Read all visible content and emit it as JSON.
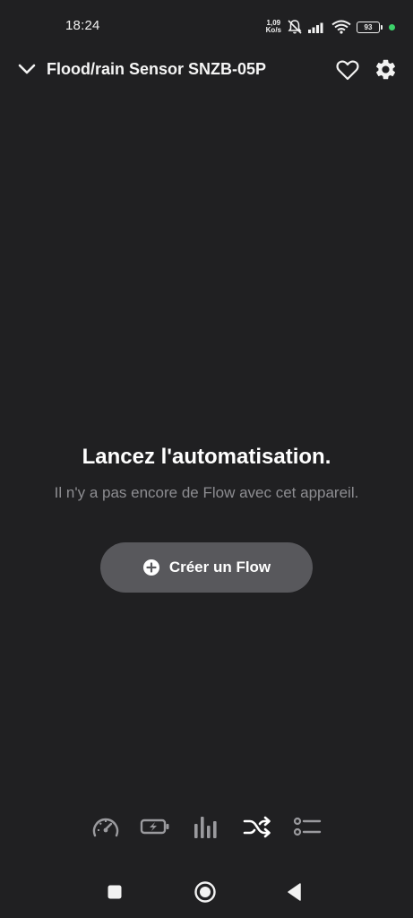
{
  "status_bar": {
    "time": "18:24",
    "net_speed_value": "1,09",
    "net_speed_unit": "Ko/s",
    "battery_level": "93",
    "icons": [
      "mute-icon",
      "signal-icon",
      "wifi-icon",
      "battery-icon",
      "privacy-dot"
    ]
  },
  "header": {
    "title": "Flood/rain Sensor SNZB-05P",
    "icons": [
      "chevron-down-icon",
      "heart-icon",
      "gear-icon"
    ]
  },
  "empty_state": {
    "headline": "Lancez l'automatisation.",
    "subtitle": "Il n'y a pas encore de Flow avec cet appareil."
  },
  "cta": {
    "label": "Créer un Flow",
    "icon": "plus-circle-icon"
  },
  "tabs": [
    {
      "icon": "gauge-icon",
      "active": false
    },
    {
      "icon": "battery-charging-icon",
      "active": false
    },
    {
      "icon": "bar-chart-icon",
      "active": false
    },
    {
      "icon": "shuffle-icon",
      "active": true
    },
    {
      "icon": "list-icon",
      "active": false
    }
  ],
  "nav_bar": {
    "icons": [
      "recents-icon",
      "home-icon",
      "back-icon"
    ]
  },
  "colors": {
    "background": "#202022",
    "button": "#58585c",
    "subtitle": "#8d8d91",
    "inactive_tab": "#9a9a9e",
    "active_tab": "#ffffff",
    "status_dot": "#3cd26a"
  }
}
